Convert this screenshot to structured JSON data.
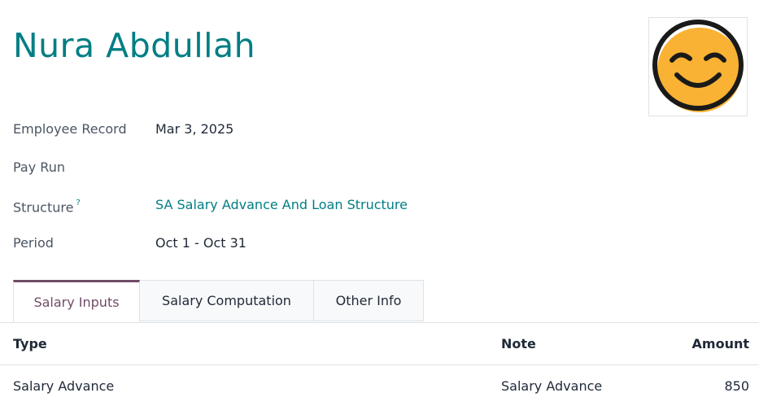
{
  "record": {
    "title": "Nura Abdullah"
  },
  "avatar": {
    "icon": "smiley-face-icon",
    "face_color": "#f9b233",
    "outline_color": "#1a1a1a"
  },
  "fields": {
    "employee_record": {
      "label": "Employee Record",
      "value": "Mar 3, 2025"
    },
    "pay_run": {
      "label": "Pay Run",
      "value": ""
    },
    "structure": {
      "label": "Structure",
      "help": "?",
      "value": "SA Salary Advance And Loan Structure"
    },
    "period": {
      "label": "Period",
      "value": "Oct 1 - Oct 31"
    }
  },
  "tabs": [
    {
      "label": "Salary Inputs",
      "active": true
    },
    {
      "label": "Salary Computation",
      "active": false
    },
    {
      "label": "Other Info",
      "active": false
    }
  ],
  "table": {
    "headers": {
      "type": "Type",
      "note": "Note",
      "amount": "Amount"
    },
    "rows": [
      {
        "type": "Salary Advance",
        "note": "Salary Advance",
        "amount": "850"
      }
    ]
  },
  "colors": {
    "brand": "#017e84",
    "active_tab": "#714b67"
  }
}
